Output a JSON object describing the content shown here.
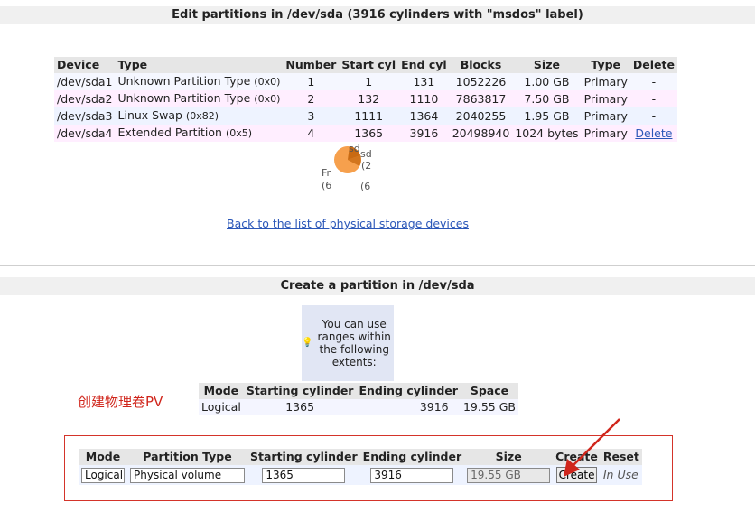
{
  "header1": "Edit partitions in /dev/sda (3916 cylinders with \"msdos\" label)",
  "partitions": {
    "columns": [
      "Device",
      "Type",
      "Number",
      "Start cyl",
      "End cyl",
      "Blocks",
      "Size",
      "Type",
      "Delete"
    ],
    "rows": [
      {
        "device": "/dev/sda1",
        "type": "Unknown Partition Type",
        "code": "(0x0)",
        "number": "1",
        "start": "1",
        "end": "131",
        "blocks": "1052226",
        "size": "1.00 GB",
        "kind": "Primary",
        "delete": "-"
      },
      {
        "device": "/dev/sda2",
        "type": "Unknown Partition Type",
        "code": "(0x0)",
        "number": "2",
        "start": "132",
        "end": "1110",
        "blocks": "7863817",
        "size": "7.50 GB",
        "kind": "Primary",
        "delete": "-"
      },
      {
        "device": "/dev/sda3",
        "type": "Linux Swap",
        "code": "(0x82)",
        "number": "3",
        "start": "1111",
        "end": "1364",
        "blocks": "2040255",
        "size": "1.95 GB",
        "kind": "Primary",
        "delete": "-"
      },
      {
        "device": "/dev/sda4",
        "type": "Extended Partition",
        "code": "(0x5)",
        "number": "4",
        "start": "1365",
        "end": "3916",
        "blocks": "20498940",
        "size": "1024 bytes",
        "kind": "Primary",
        "delete": "Delete"
      }
    ]
  },
  "pie_labels": {
    "free": "Fr",
    "free_sub": "(6",
    "sd_a": "sd",
    "sd_b": "sd",
    "sd_c": "(2",
    "sd_d": "(6"
  },
  "back_link": "Back to the list of physical storage devices",
  "header2": "Create a partition in /dev/sda",
  "tip": "You can use ranges within the following extents:",
  "extents": {
    "columns": [
      "Mode",
      "Starting cylinder",
      "Ending cylinder",
      "Space"
    ],
    "rows": [
      {
        "mode": "Logical",
        "start": "1365",
        "end": "3916",
        "space": "19.55 GB"
      }
    ]
  },
  "annotation": "创建物理卷PV",
  "create": {
    "columns": [
      "Mode",
      "Partition Type",
      "Starting cylinder",
      "Ending cylinder",
      "Size",
      "Create",
      "Reset"
    ],
    "mode_value": "Logical",
    "type_value": "Physical volume",
    "start_value": "1365",
    "end_value": "3916",
    "size_value": "19.55 GB",
    "create_button": "Create",
    "in_use": "In Use"
  },
  "colors": {
    "annotation": "#d0261c",
    "pie_orange": "#f6a04d",
    "pie_dark": "#c96a12",
    "link": "#2b57b8"
  }
}
